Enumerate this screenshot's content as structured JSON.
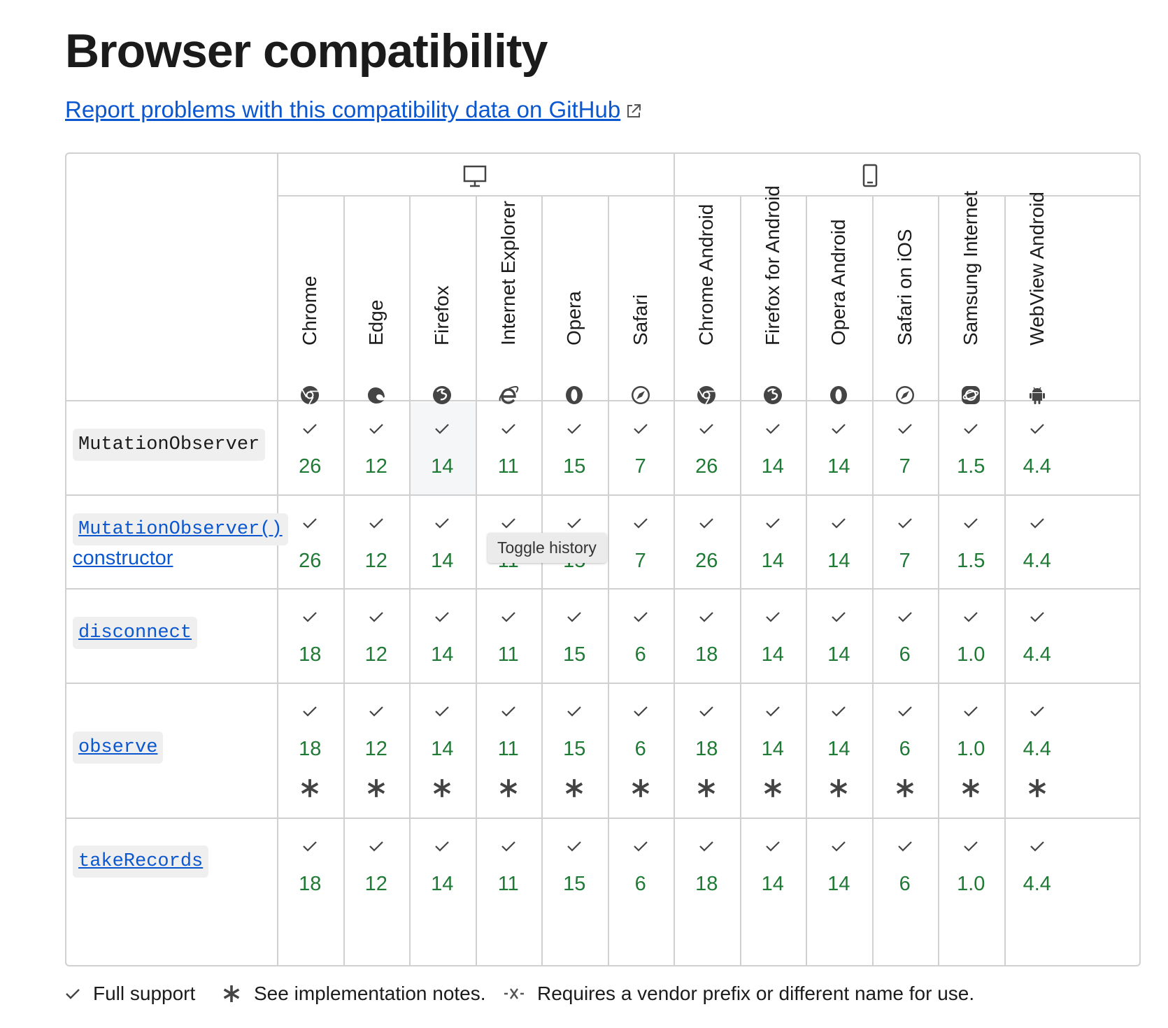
{
  "page": {
    "title": "Browser compatibility",
    "report_link": "Report problems with this compatibility data on GitHub"
  },
  "platforms": [
    {
      "name": "desktop",
      "icon": "desktop-icon"
    },
    {
      "name": "mobile",
      "icon": "mobile-icon"
    }
  ],
  "browsers": [
    {
      "name": "Chrome",
      "icon": "chrome-icon"
    },
    {
      "name": "Edge",
      "icon": "edge-icon"
    },
    {
      "name": "Firefox",
      "icon": "firefox-icon"
    },
    {
      "name": "Internet Explorer",
      "icon": "internet-explorer-icon"
    },
    {
      "name": "Opera",
      "icon": "opera-icon"
    },
    {
      "name": "Safari",
      "icon": "safari-icon"
    },
    {
      "name": "Chrome Android",
      "icon": "chrome-icon"
    },
    {
      "name": "Firefox for Android",
      "icon": "firefox-icon"
    },
    {
      "name": "Opera Android",
      "icon": "opera-icon"
    },
    {
      "name": "Safari on iOS",
      "icon": "safari-icon"
    },
    {
      "name": "Samsung Internet",
      "icon": "samsung-internet-icon"
    },
    {
      "name": "WebView Android",
      "icon": "android-icon"
    }
  ],
  "features": [
    {
      "name": "MutationObserver",
      "link": false,
      "versions": [
        "26",
        "12",
        "14",
        "11",
        "15",
        "7",
        "26",
        "14",
        "14",
        "7",
        "1.5",
        "4.4"
      ],
      "notes": false
    },
    {
      "name": "MutationObserver()",
      "suffix": "constructor",
      "link": true,
      "versions": [
        "26",
        "12",
        "14",
        "11",
        "15",
        "7",
        "26",
        "14",
        "14",
        "7",
        "1.5",
        "4.4"
      ],
      "notes": false
    },
    {
      "name": "disconnect",
      "link": true,
      "versions": [
        "18",
        "12",
        "14",
        "11",
        "15",
        "6",
        "18",
        "14",
        "14",
        "6",
        "1.0",
        "4.4"
      ],
      "notes": false
    },
    {
      "name": "observe",
      "link": true,
      "versions": [
        "18",
        "12",
        "14",
        "11",
        "15",
        "6",
        "18",
        "14",
        "14",
        "6",
        "1.0",
        "4.4"
      ],
      "notes": true
    },
    {
      "name": "takeRecords",
      "link": true,
      "versions": [
        "18",
        "12",
        "14",
        "11",
        "15",
        "6",
        "18",
        "14",
        "14",
        "6",
        "1.0",
        "4.4"
      ],
      "notes": false
    }
  ],
  "tooltip": "Toggle history",
  "legend": {
    "full_support": "Full support",
    "notes": "See implementation notes.",
    "prefix": "Requires a vendor prefix or different name for use."
  },
  "colors": {
    "support": "#1e7a34",
    "link": "#0b57d0",
    "border": "#d0d0d0"
  }
}
